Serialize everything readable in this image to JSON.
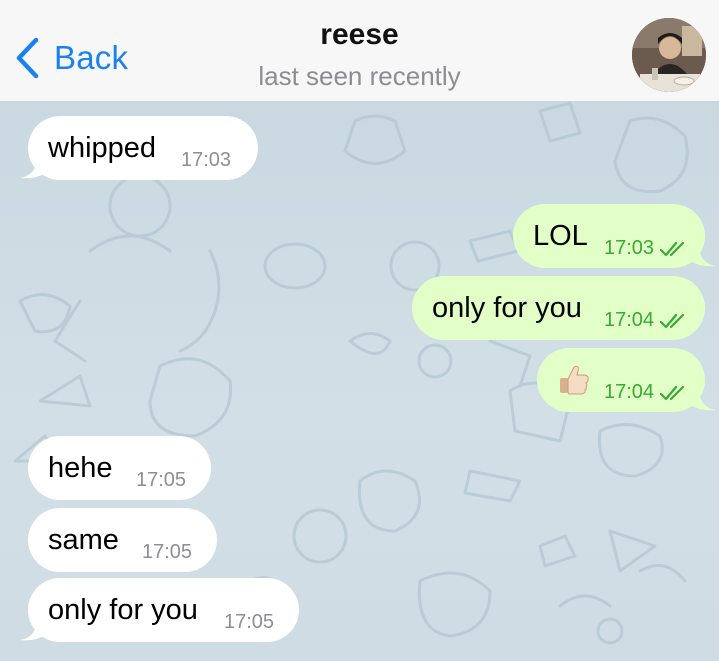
{
  "header": {
    "back_label": "Back",
    "contact_name": "reese",
    "status": "last seen recently",
    "avatar_icon": "contact-photo"
  },
  "colors": {
    "accent": "#1a82f0",
    "incoming_bubble": "#ffffff",
    "outgoing_bubble": "#e2ffc8",
    "outgoing_time": "#39a935",
    "incoming_time": "#8e8e93",
    "chat_background": "#cfdbe3"
  },
  "messages": [
    {
      "direction": "incoming",
      "text": "whipped",
      "time": "17:03"
    },
    {
      "direction": "outgoing",
      "text": "LOL",
      "time": "17:03",
      "status": "read"
    },
    {
      "direction": "outgoing",
      "text": "only for you",
      "time": "17:04",
      "status": "read"
    },
    {
      "direction": "outgoing",
      "text": "",
      "emoji": "thumbs-up",
      "time": "17:04",
      "status": "read"
    },
    {
      "direction": "incoming",
      "text": "hehe",
      "time": "17:05"
    },
    {
      "direction": "incoming",
      "text": "same",
      "time": "17:05"
    },
    {
      "direction": "incoming",
      "text": "only for you",
      "time": "17:05"
    }
  ]
}
